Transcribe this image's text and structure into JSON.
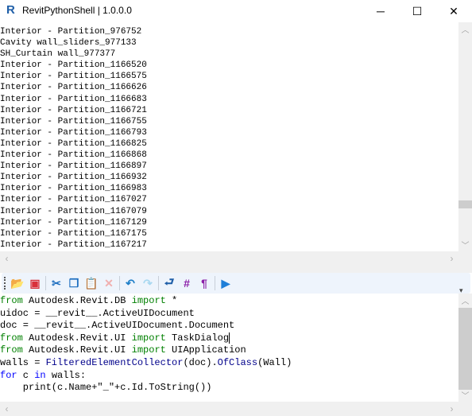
{
  "window": {
    "title": "RevitPythonShell | 1.0.0.0",
    "app_icon": "revit-r-icon",
    "app_icon_letter": "R",
    "minimize": "─",
    "maximize": "☐",
    "close": "✕"
  },
  "output": {
    "lines": [
      "Interior - Partition_976752",
      "Cavity wall_sliders_977133",
      "SH_Curtain wall_977377",
      "Interior - Partition_1166520",
      "Interior - Partition_1166575",
      "Interior - Partition_1166626",
      "Interior - Partition_1166683",
      "Interior - Partition_1166721",
      "Interior - Partition_1166755",
      "Interior - Partition_1166793",
      "Interior - Partition_1166825",
      "Interior - Partition_1166868",
      "Interior - Partition_1166897",
      "Interior - Partition_1166932",
      "Interior - Partition_1166983",
      "Interior - Partition_1167027",
      "Interior - Partition_1167079",
      "Interior - Partition_1167129",
      "Interior - Partition_1167175",
      "Interior - Partition_1167217"
    ],
    "scroll_position": 0.8
  },
  "toolbar": {
    "buttons": [
      {
        "name": "open-icon",
        "glyph": "📂",
        "color": "#f0a020"
      },
      {
        "name": "save-icon",
        "glyph": "▣",
        "color": "#d9303a"
      },
      {
        "name": "cut-icon",
        "glyph": "✂",
        "color": "#1f6fc0"
      },
      {
        "name": "copy-icon",
        "glyph": "❐",
        "color": "#1f6fc0"
      },
      {
        "name": "paste-icon",
        "glyph": "📋",
        "color": "#5a7fa8"
      },
      {
        "name": "delete-icon",
        "glyph": "✕",
        "color": "#f0b0b0"
      },
      {
        "name": "undo-icon",
        "glyph": "↶",
        "color": "#1f7fc8"
      },
      {
        "name": "redo-icon",
        "glyph": "↷",
        "color": "#a8d8f0"
      },
      {
        "name": "word-wrap-icon",
        "glyph": "⮐",
        "color": "#1f5fa8"
      },
      {
        "name": "line-numbers-icon",
        "glyph": "#",
        "color": "#8b1fa8"
      },
      {
        "name": "show-whitespace-icon",
        "glyph": "¶",
        "color": "#8b1fa8"
      },
      {
        "name": "run-icon",
        "glyph": "▶",
        "color": "#1f7fd8"
      }
    ]
  },
  "editor": {
    "code": [
      [
        {
          "t": "from",
          "c": "kw"
        },
        {
          "t": " Autodesk.Revit.DB "
        },
        {
          "t": "import",
          "c": "kw"
        },
        {
          "t": " *"
        }
      ],
      [
        {
          "t": "uidoc = __revit__.ActiveUIDocument"
        }
      ],
      [
        {
          "t": "doc = __revit__.ActiveUIDocument.Document"
        }
      ],
      [
        {
          "t": "from",
          "c": "kw"
        },
        {
          "t": " Autodesk.Revit.UI "
        },
        {
          "t": "import",
          "c": "kw"
        },
        {
          "t": " TaskDialog"
        }
      ],
      [
        {
          "t": "from",
          "c": "kw"
        },
        {
          "t": " Autodesk.Revit.UI "
        },
        {
          "t": "import",
          "c": "kw"
        },
        {
          "t": " UIApplication"
        }
      ],
      [
        {
          "t": "walls = "
        },
        {
          "t": "FilteredElementCollector",
          "c": "fn"
        },
        {
          "t": "(doc)."
        },
        {
          "t": "OfClass",
          "c": "fn"
        },
        {
          "t": "(Wall)"
        }
      ],
      [
        {
          "t": "for",
          "c": "kw2"
        },
        {
          "t": " c "
        },
        {
          "t": "in",
          "c": "kw2"
        },
        {
          "t": " walls:"
        }
      ],
      [
        {
          "t": "    print(c.Name+\"_\"+c.Id.ToString())"
        }
      ]
    ],
    "cursor_line": 3
  }
}
